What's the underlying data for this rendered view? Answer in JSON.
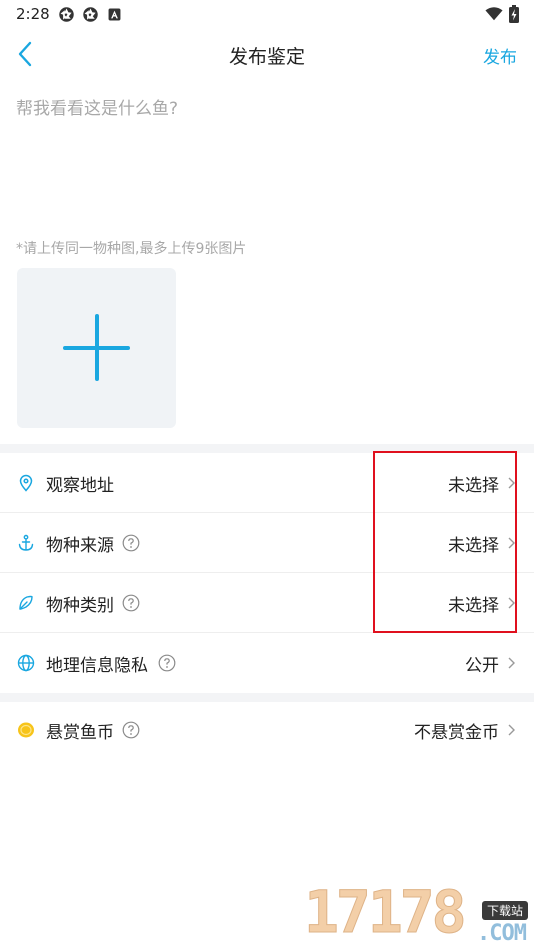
{
  "status_bar": {
    "time": "2:28",
    "left_icons": [
      "aperture-icon",
      "aperture-icon",
      "a-badge-icon"
    ],
    "right_icons": [
      "wifi-icon",
      "battery-charging-icon"
    ]
  },
  "header": {
    "title": "发布鉴定",
    "publish_label": "发布",
    "accent_color": "#1aa7e0"
  },
  "question": {
    "placeholder": "帮我看看这是什么鱼?",
    "value": ""
  },
  "upload": {
    "hint": "*请上传同一物种图,最多上传9张图片",
    "add_icon": "plus-icon"
  },
  "rows": [
    {
      "icon": "location-pin-icon",
      "label": "观察地址",
      "has_help": false,
      "value": "未选择"
    },
    {
      "icon": "anchor-icon",
      "label": "物种来源",
      "has_help": true,
      "value": "未选择"
    },
    {
      "icon": "leaf-icon",
      "label": "物种类别",
      "has_help": true,
      "value": "未选择"
    },
    {
      "icon": "globe-icon",
      "label": "地理信息隐私",
      "has_help": true,
      "value": "公开"
    }
  ],
  "reward": {
    "icon": "coin-icon",
    "label": "悬赏鱼币",
    "has_help": true,
    "value": "不悬赏金币"
  },
  "highlight_color": "#e0101e",
  "watermark": {
    "digits": "17178",
    "badge": "下载站",
    "suffix": ".COM"
  }
}
